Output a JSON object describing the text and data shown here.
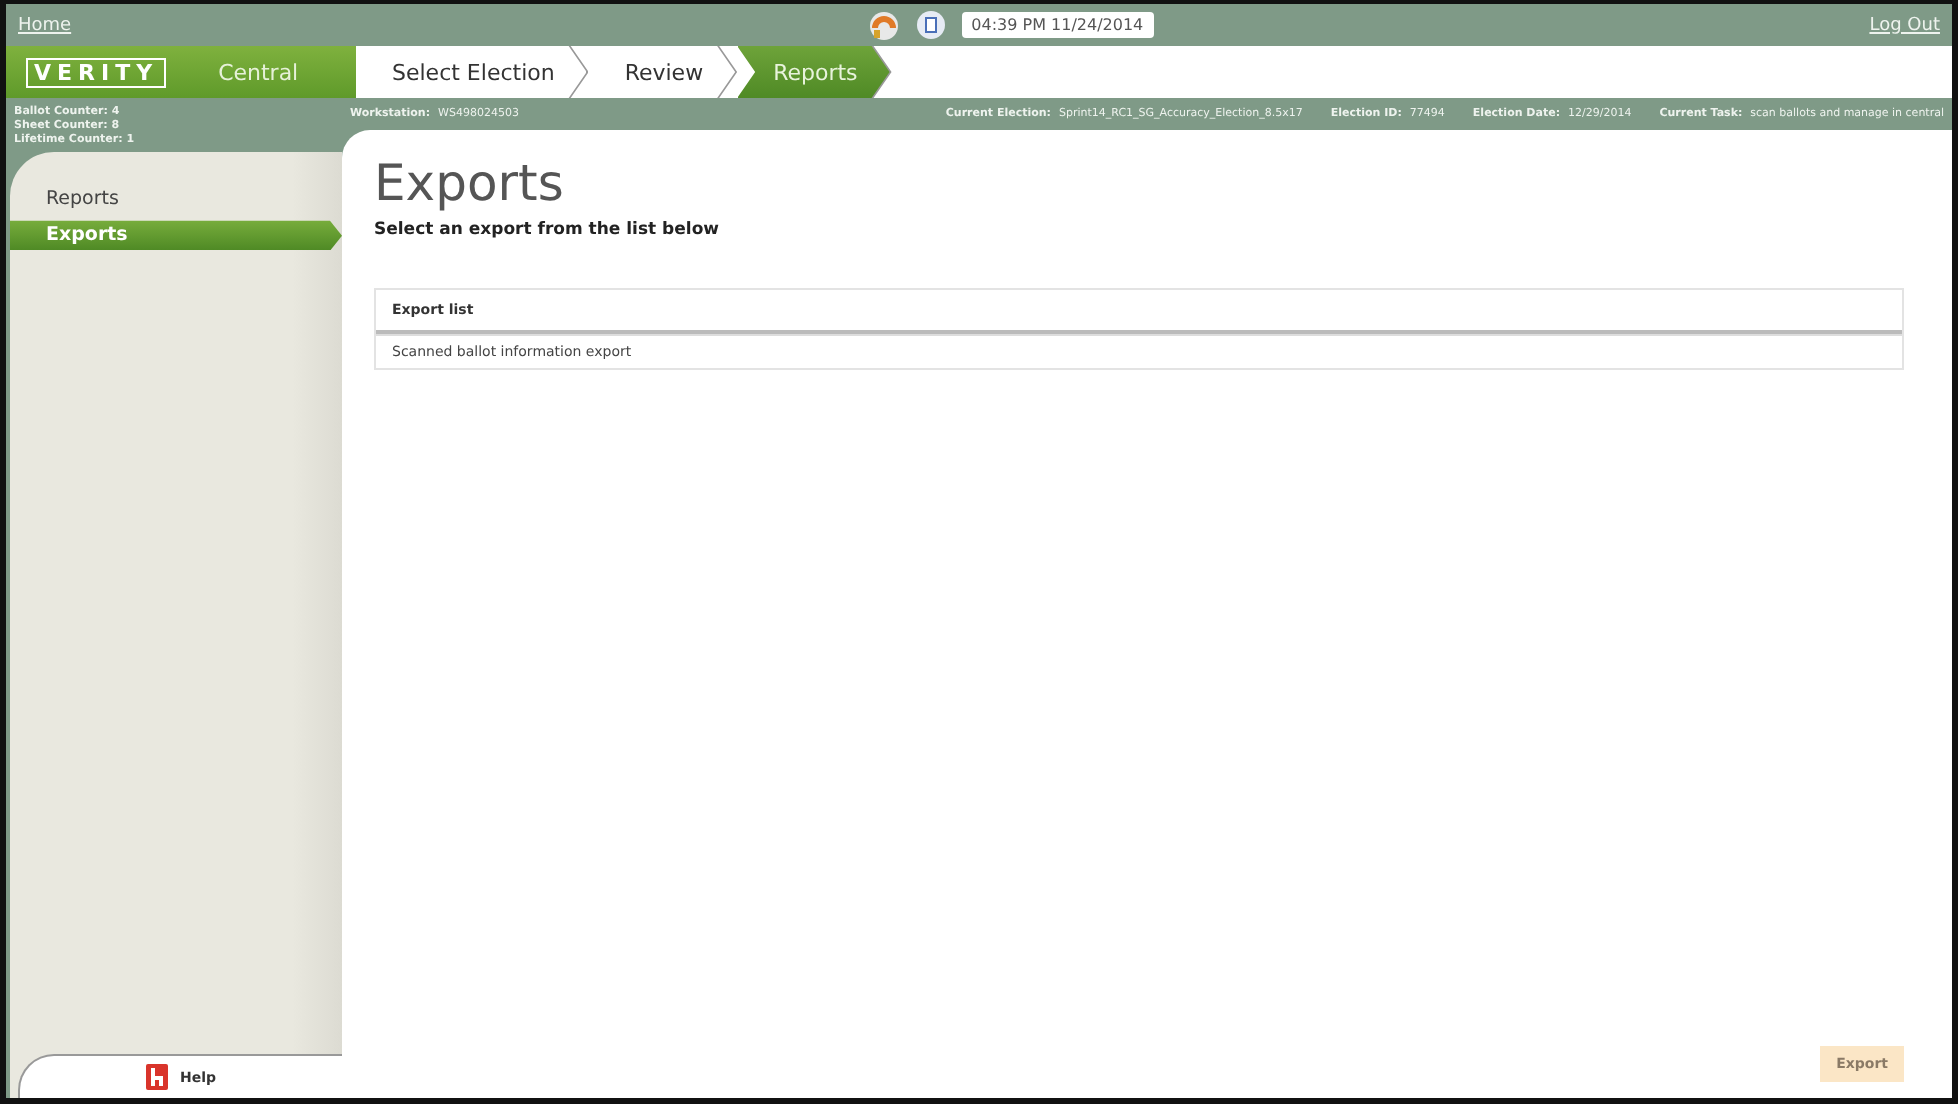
{
  "top_bar": {
    "home_link": "Home",
    "time": "04:39 PM 11/24/2014",
    "logout_link": "Log Out"
  },
  "header": {
    "logo": "VERITY",
    "product": "Central",
    "steps": [
      {
        "label": "Select Election",
        "selected": false
      },
      {
        "label": "Review",
        "selected": false
      },
      {
        "label": "Reports",
        "selected": true
      }
    ]
  },
  "counters": [
    "Ballot Counter: 4",
    "Sheet Counter: 8",
    "Lifetime Counter: 1"
  ],
  "info_bar": {
    "workstation": {
      "label": "Workstation:",
      "value": "WS498024503"
    },
    "fields": [
      {
        "label": "Current Election:",
        "value": "Sprint14_RC1_SG_Accuracy_Election_8.5x17"
      },
      {
        "label": "Election ID:",
        "value": "77494"
      },
      {
        "label": "Election Date:",
        "value": "12/29/2014"
      },
      {
        "label": "Current Task:",
        "value": "scan ballots and manage in central"
      }
    ]
  },
  "sidebar": {
    "items": [
      {
        "label": "Reports",
        "selected": false
      },
      {
        "label": "Exports",
        "selected": true
      }
    ],
    "help": "Help"
  },
  "content": {
    "title": "Exports",
    "instruction": "Select an export from the list below",
    "list": {
      "heading": "Export list",
      "rows": [
        "Scanned ballot information export"
      ]
    },
    "export_button": {
      "label": "Export",
      "disabled": true
    }
  }
}
